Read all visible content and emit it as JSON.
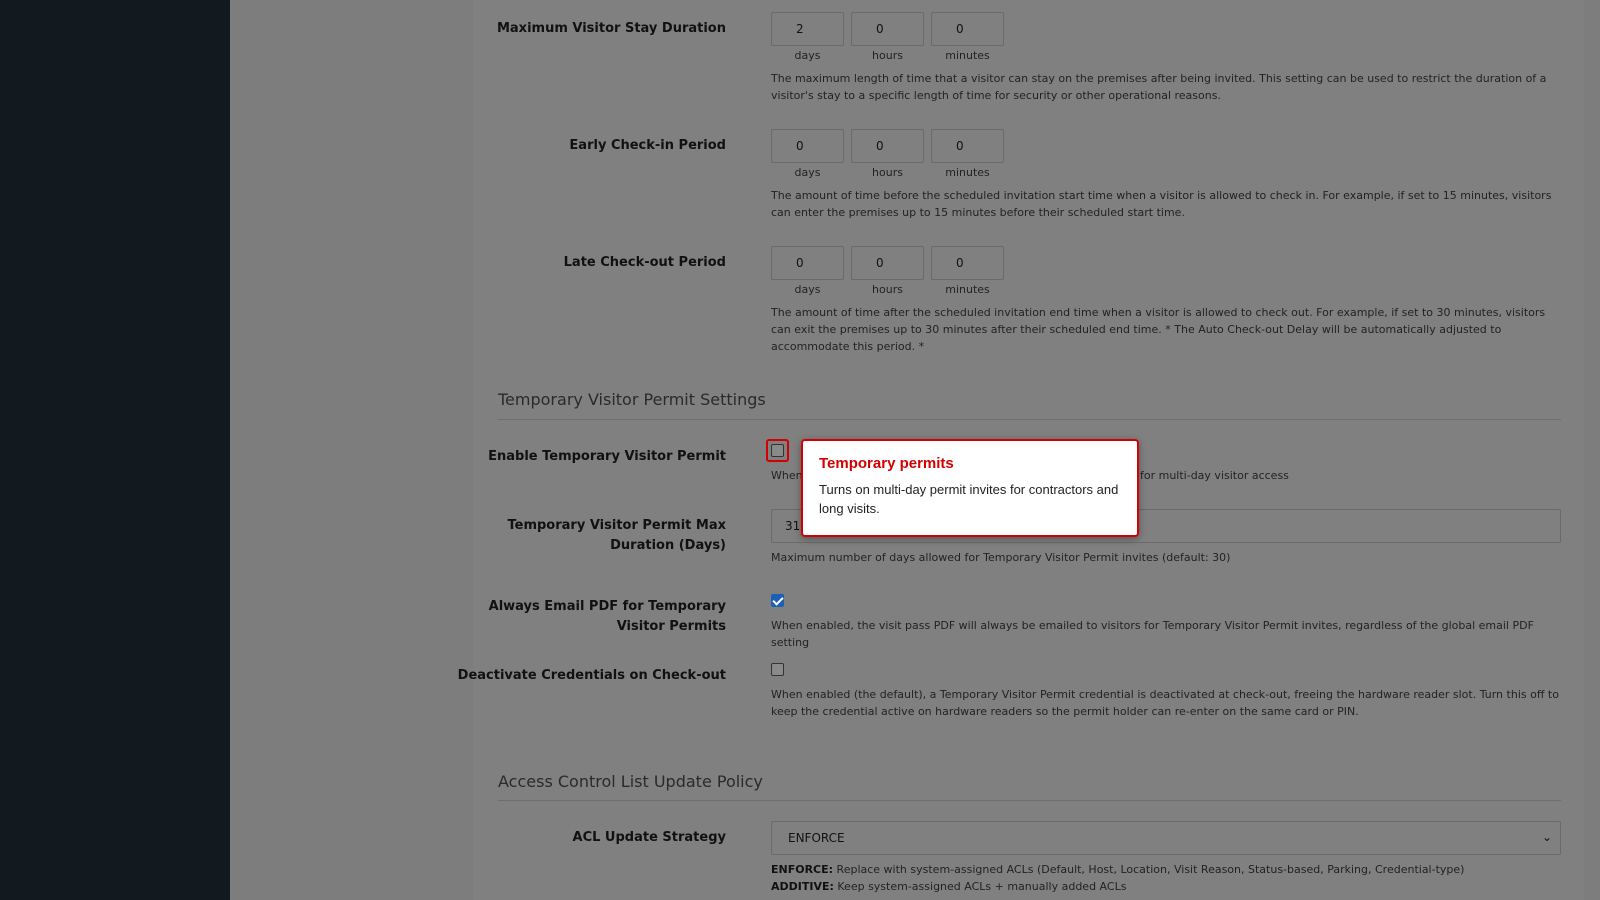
{
  "colors": {
    "sidebar": "#131a1f",
    "overlay": "#7d7d7d",
    "accent": "#d40000",
    "checkbox_checked": "#1c5fb8"
  },
  "units": {
    "days": "days",
    "hours": "hours",
    "minutes": "minutes"
  },
  "max_stay": {
    "label": "Maximum Visitor Stay Duration",
    "days": "2",
    "hours": "0",
    "minutes": "0",
    "help": "The maximum length of time that a visitor can stay on the premises after being invited. This setting can be used to restrict the duration of a visitor's stay to a specific length of time for security or other operational reasons."
  },
  "early_checkin": {
    "label": "Early Check-in Period",
    "days": "0",
    "hours": "0",
    "minutes": "0",
    "help": "The amount of time before the scheduled invitation start time when a visitor is allowed to check in. For example, if set to 15 minutes, visitors can enter the premises up to 15 minutes before their scheduled start time."
  },
  "late_checkout": {
    "label": "Late Check-out Period",
    "days": "0",
    "hours": "0",
    "minutes": "0",
    "help": "The amount of time after the scheduled invitation end time when a visitor is allowed to check out. For example, if set to 30 minutes, visitors can exit the premises up to 30 minutes after their scheduled end time. * The Auto Check-out Delay will be automatically adjusted to accommodate this period. *"
  },
  "temp_permit_section": {
    "title": "Temporary Visitor Permit Settings"
  },
  "enable_temp_permit": {
    "label": "Enable Temporary Visitor Permit",
    "checked": false,
    "help_left": "When",
    "help_right": "es for multi-day visitor access"
  },
  "temp_permit_max": {
    "label_line1": "Temporary Visitor Permit Max",
    "label_line2": "Duration (Days)",
    "value": "31",
    "help": "Maximum number of days allowed for Temporary Visitor Permit invites (default: 30)"
  },
  "always_email_pdf": {
    "label_line1": "Always Email PDF for Temporary",
    "label_line2": "Visitor Permits",
    "checked": true,
    "help": "When enabled, the visit pass PDF will always be emailed to visitors for Temporary Visitor Permit invites, regardless of the global email PDF setting"
  },
  "deactivate_credentials": {
    "label": "Deactivate Credentials on Check-out",
    "checked": false,
    "help": "When enabled (the default), a Temporary Visitor Permit credential is deactivated at check-out, freeing the hardware reader slot. Turn this off to keep the credential active on hardware readers so the permit holder can re-enter on the same card or PIN."
  },
  "acl_section": {
    "title": "Access Control List Update Policy"
  },
  "acl_strategy": {
    "label": "ACL Update Strategy",
    "selected": "ENFORCE",
    "options_help": [
      {
        "key": "ENFORCE:",
        "text": " Replace with system-assigned ACLs (Default, Host, Location, Visit Reason, Status-based, Parking, Credential-type)"
      },
      {
        "key": "ADDITIVE:",
        "text": " Keep system-assigned ACLs + manually added ACLs"
      }
    ]
  },
  "tooltip": {
    "title": "Temporary permits",
    "body": "Turns on multi-day permit invites for contractors and long visits."
  }
}
